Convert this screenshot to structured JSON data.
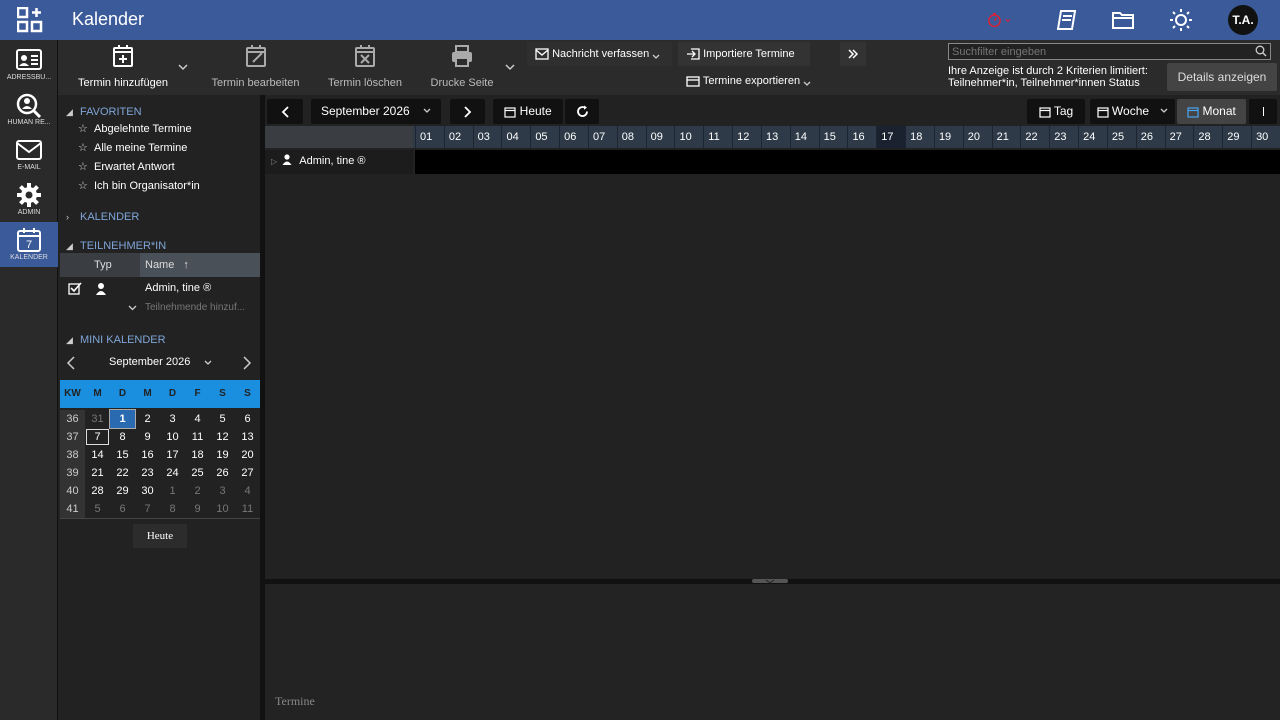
{
  "app": {
    "title": "Kalender",
    "user_initials": "T.A."
  },
  "nav": [
    {
      "label": "ADRESSBU...",
      "icon": "addressbook-icon"
    },
    {
      "label": "HUMAN RE...",
      "icon": "person-search-icon"
    },
    {
      "label": "E-MAIL",
      "icon": "mail-icon"
    },
    {
      "label": "ADMIN",
      "icon": "gear-icon"
    },
    {
      "label": "KALENDER",
      "icon": "calendar-icon"
    }
  ],
  "toolbar": {
    "add": "Termin hinzufügen",
    "edit": "Termin bearbeiten",
    "delete": "Termin löschen",
    "print": "Drucke Seite",
    "compose": "Nachricht verfassen",
    "import": "Importiere Termine",
    "export": "Termine exportieren",
    "search_placeholder": "Suchfilter eingeben",
    "filter_text": "Ihre Anzeige ist durch 2 Kriterien limitiert: Teilnehmer*in, Teilnehmer*innen Status",
    "details": "Details anzeigen"
  },
  "favorites": {
    "title": "FAVORITEN",
    "items": [
      "Abgelehnte Termine",
      "Alle meine Termine",
      "Erwartet Antwort",
      "Ich bin Organisator*in"
    ]
  },
  "calendar_section": "KALENDER",
  "participants": {
    "title": "TEILNEHMER*IN",
    "col_type": "Typ",
    "col_name": "Name",
    "rows": [
      {
        "name": "Admin, tine ®"
      }
    ],
    "add_placeholder": "Teilnehmende hinzuf..."
  },
  "mini_calendar": {
    "title": "MINI KALENDER",
    "month": "September 2026",
    "weekdays": [
      "KW",
      "M",
      "D",
      "M",
      "D",
      "F",
      "S",
      "S"
    ],
    "weeks": [
      [
        "36",
        "31",
        "1",
        "2",
        "3",
        "4",
        "5",
        "6"
      ],
      [
        "37",
        "7",
        "8",
        "9",
        "10",
        "11",
        "12",
        "13"
      ],
      [
        "38",
        "14",
        "15",
        "16",
        "17",
        "18",
        "19",
        "20"
      ],
      [
        "39",
        "21",
        "22",
        "23",
        "24",
        "25",
        "26",
        "27"
      ],
      [
        "40",
        "28",
        "29",
        "30",
        "1",
        "2",
        "3",
        "4"
      ],
      [
        "41",
        "5",
        "6",
        "7",
        "8",
        "9",
        "10",
        "11"
      ]
    ],
    "today_button": "Heute"
  },
  "main": {
    "month": "September 2026",
    "today": "Heute",
    "view_day": "Tag",
    "view_week": "Woche",
    "view_month": "Monat",
    "days": [
      "01",
      "02",
      "03",
      "04",
      "05",
      "06",
      "07",
      "08",
      "09",
      "10",
      "11",
      "12",
      "13",
      "14",
      "15",
      "16",
      "17",
      "18",
      "19",
      "20",
      "21",
      "22",
      "23",
      "24",
      "25",
      "26",
      "27",
      "28",
      "29",
      "30"
    ],
    "highlight_day": "17",
    "row_name": "Admin, tine ®",
    "lower_label": "Termine"
  },
  "colors": {
    "brand": "#3b5a9a",
    "accent": "#1a8fe0",
    "link": "#7fa6d8"
  }
}
